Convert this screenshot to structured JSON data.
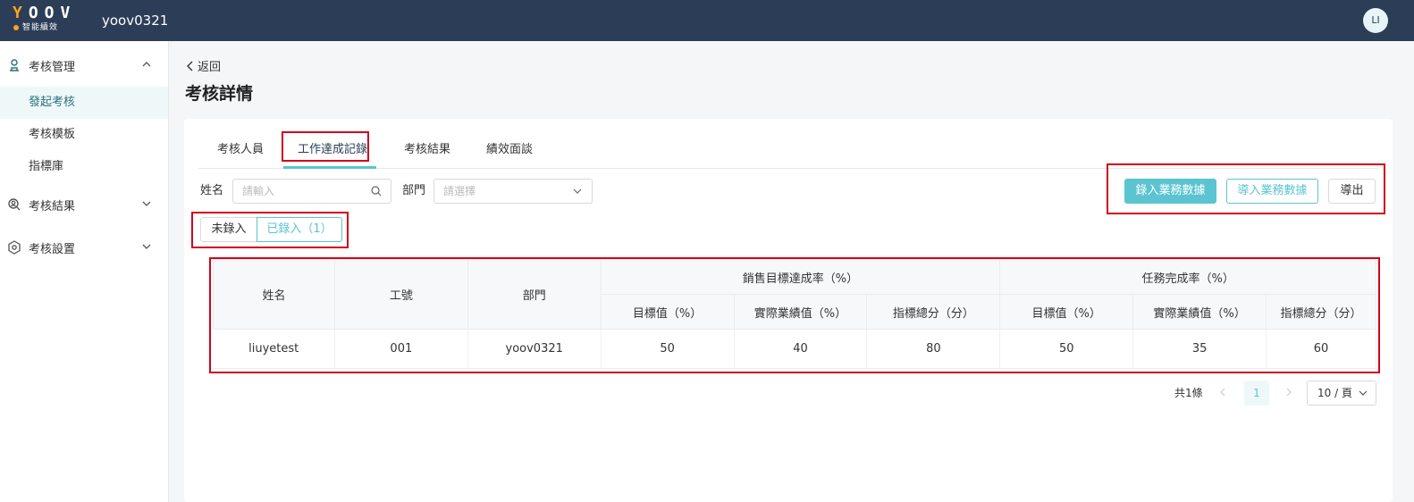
{
  "header": {
    "logo_text": "YOOV",
    "logo_sub": "智能績效",
    "company": "yoov0321",
    "avatar_initials": "LI"
  },
  "sidebar": {
    "groups": [
      {
        "label": "考核管理",
        "icon": "user-stamp-icon",
        "expanded": true,
        "items": [
          {
            "label": "發起考核",
            "active": true
          },
          {
            "label": "考核模板"
          },
          {
            "label": "指標庫"
          }
        ]
      },
      {
        "label": "考核結果",
        "icon": "search-person-icon",
        "expanded": false
      },
      {
        "label": "考核設置",
        "icon": "hexagon-gear-icon",
        "expanded": false
      }
    ]
  },
  "main": {
    "back_label": "返回",
    "title": "考核詳情",
    "tabs": [
      {
        "label": "考核人員"
      },
      {
        "label": "工作達成記錄",
        "active": true
      },
      {
        "label": "考核結果"
      },
      {
        "label": "績效面談"
      }
    ],
    "filters": {
      "name_label": "姓名",
      "name_placeholder": "請輸入",
      "dept_label": "部門",
      "dept_placeholder": "請選擇"
    },
    "actions": {
      "enter_data": "錄入業務數據",
      "import_data": "導入業務數據",
      "export": "導出"
    },
    "segments": [
      {
        "label": "未錄入"
      },
      {
        "label": "已錄入（1）",
        "active": true
      }
    ],
    "table": {
      "col_name": "姓名",
      "col_id": "工號",
      "col_dept": "部門",
      "group1": "銷售目標達成率（%）",
      "group2": "任務完成率（%）",
      "sub_target": "目標值（%）",
      "sub_actual": "實際業績值（%）",
      "sub_score": "指標總分（分）",
      "rows": [
        {
          "name": "liuyetest",
          "id": "001",
          "dept": "yoov0321",
          "g1_target": "50",
          "g1_actual": "40",
          "g1_score": "80",
          "g2_target": "50",
          "g2_actual": "35",
          "g2_score": "60"
        }
      ]
    },
    "pagination": {
      "total": "共1條",
      "current_page": "1",
      "page_size": "10 / 頁"
    }
  },
  "colors": {
    "topbar": "#2c3e57",
    "accent": "#5bc4d0",
    "highlight_box": "#d0021b"
  }
}
